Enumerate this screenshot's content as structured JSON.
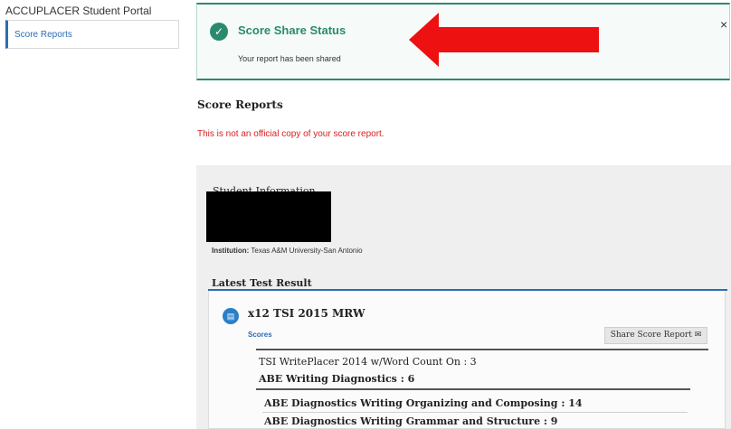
{
  "sidebar": {
    "portal_title": "ACCUPLACER Student Portal",
    "items": [
      {
        "label": "Score Reports"
      }
    ]
  },
  "alert": {
    "title": "Score Share Status",
    "message": "Your report has been shared",
    "close_label": "×"
  },
  "page": {
    "section_title": "Score Reports",
    "warning": "This is not an official copy of your score report."
  },
  "student": {
    "heading": "Student Information",
    "institution_label": "Institution:",
    "institution_value": "Texas A&M University-San Antonio"
  },
  "latest": {
    "heading": "Latest Test Result",
    "test_name": "x12 TSI 2015 MRW",
    "scores_label": "Scores",
    "share_button": "Share Score Report",
    "scores": [
      "TSI WritePlacer 2014 w/Word Count On : 3",
      "ABE Writing Diagnostics : 6",
      "ABE Diagnostics Writing Organizing and Composing : 14",
      "ABE Diagnostics Writing Grammar and Structure : 9"
    ]
  },
  "colors": {
    "success": "#2b8a6e",
    "link": "#2a6db5",
    "warning": "#d62020",
    "arrow": "#ee1111"
  },
  "icons": {
    "check": "check-circle-icon",
    "close": "close-icon",
    "test": "test-icon",
    "envelope": "envelope-icon",
    "arrow": "arrow-left-icon"
  }
}
